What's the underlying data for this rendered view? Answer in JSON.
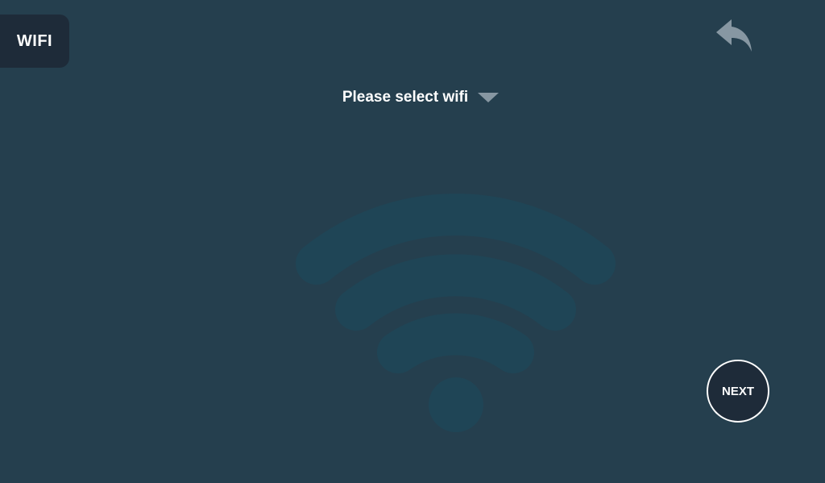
{
  "header": {
    "tab_label": "WIFI",
    "back_icon": "reply-arrow-icon"
  },
  "wifi_select": {
    "label": "Please select wifi",
    "caret_icon": "chevron-down-icon"
  },
  "watermark": {
    "icon": "wifi-signal-icon"
  },
  "footer": {
    "next_label": "NEXT"
  },
  "colors": {
    "background": "#253f4e",
    "tab_background": "#1e2b39",
    "watermark": "#1e4758",
    "back_icon": "#8797a2",
    "text": "#ffffff"
  }
}
